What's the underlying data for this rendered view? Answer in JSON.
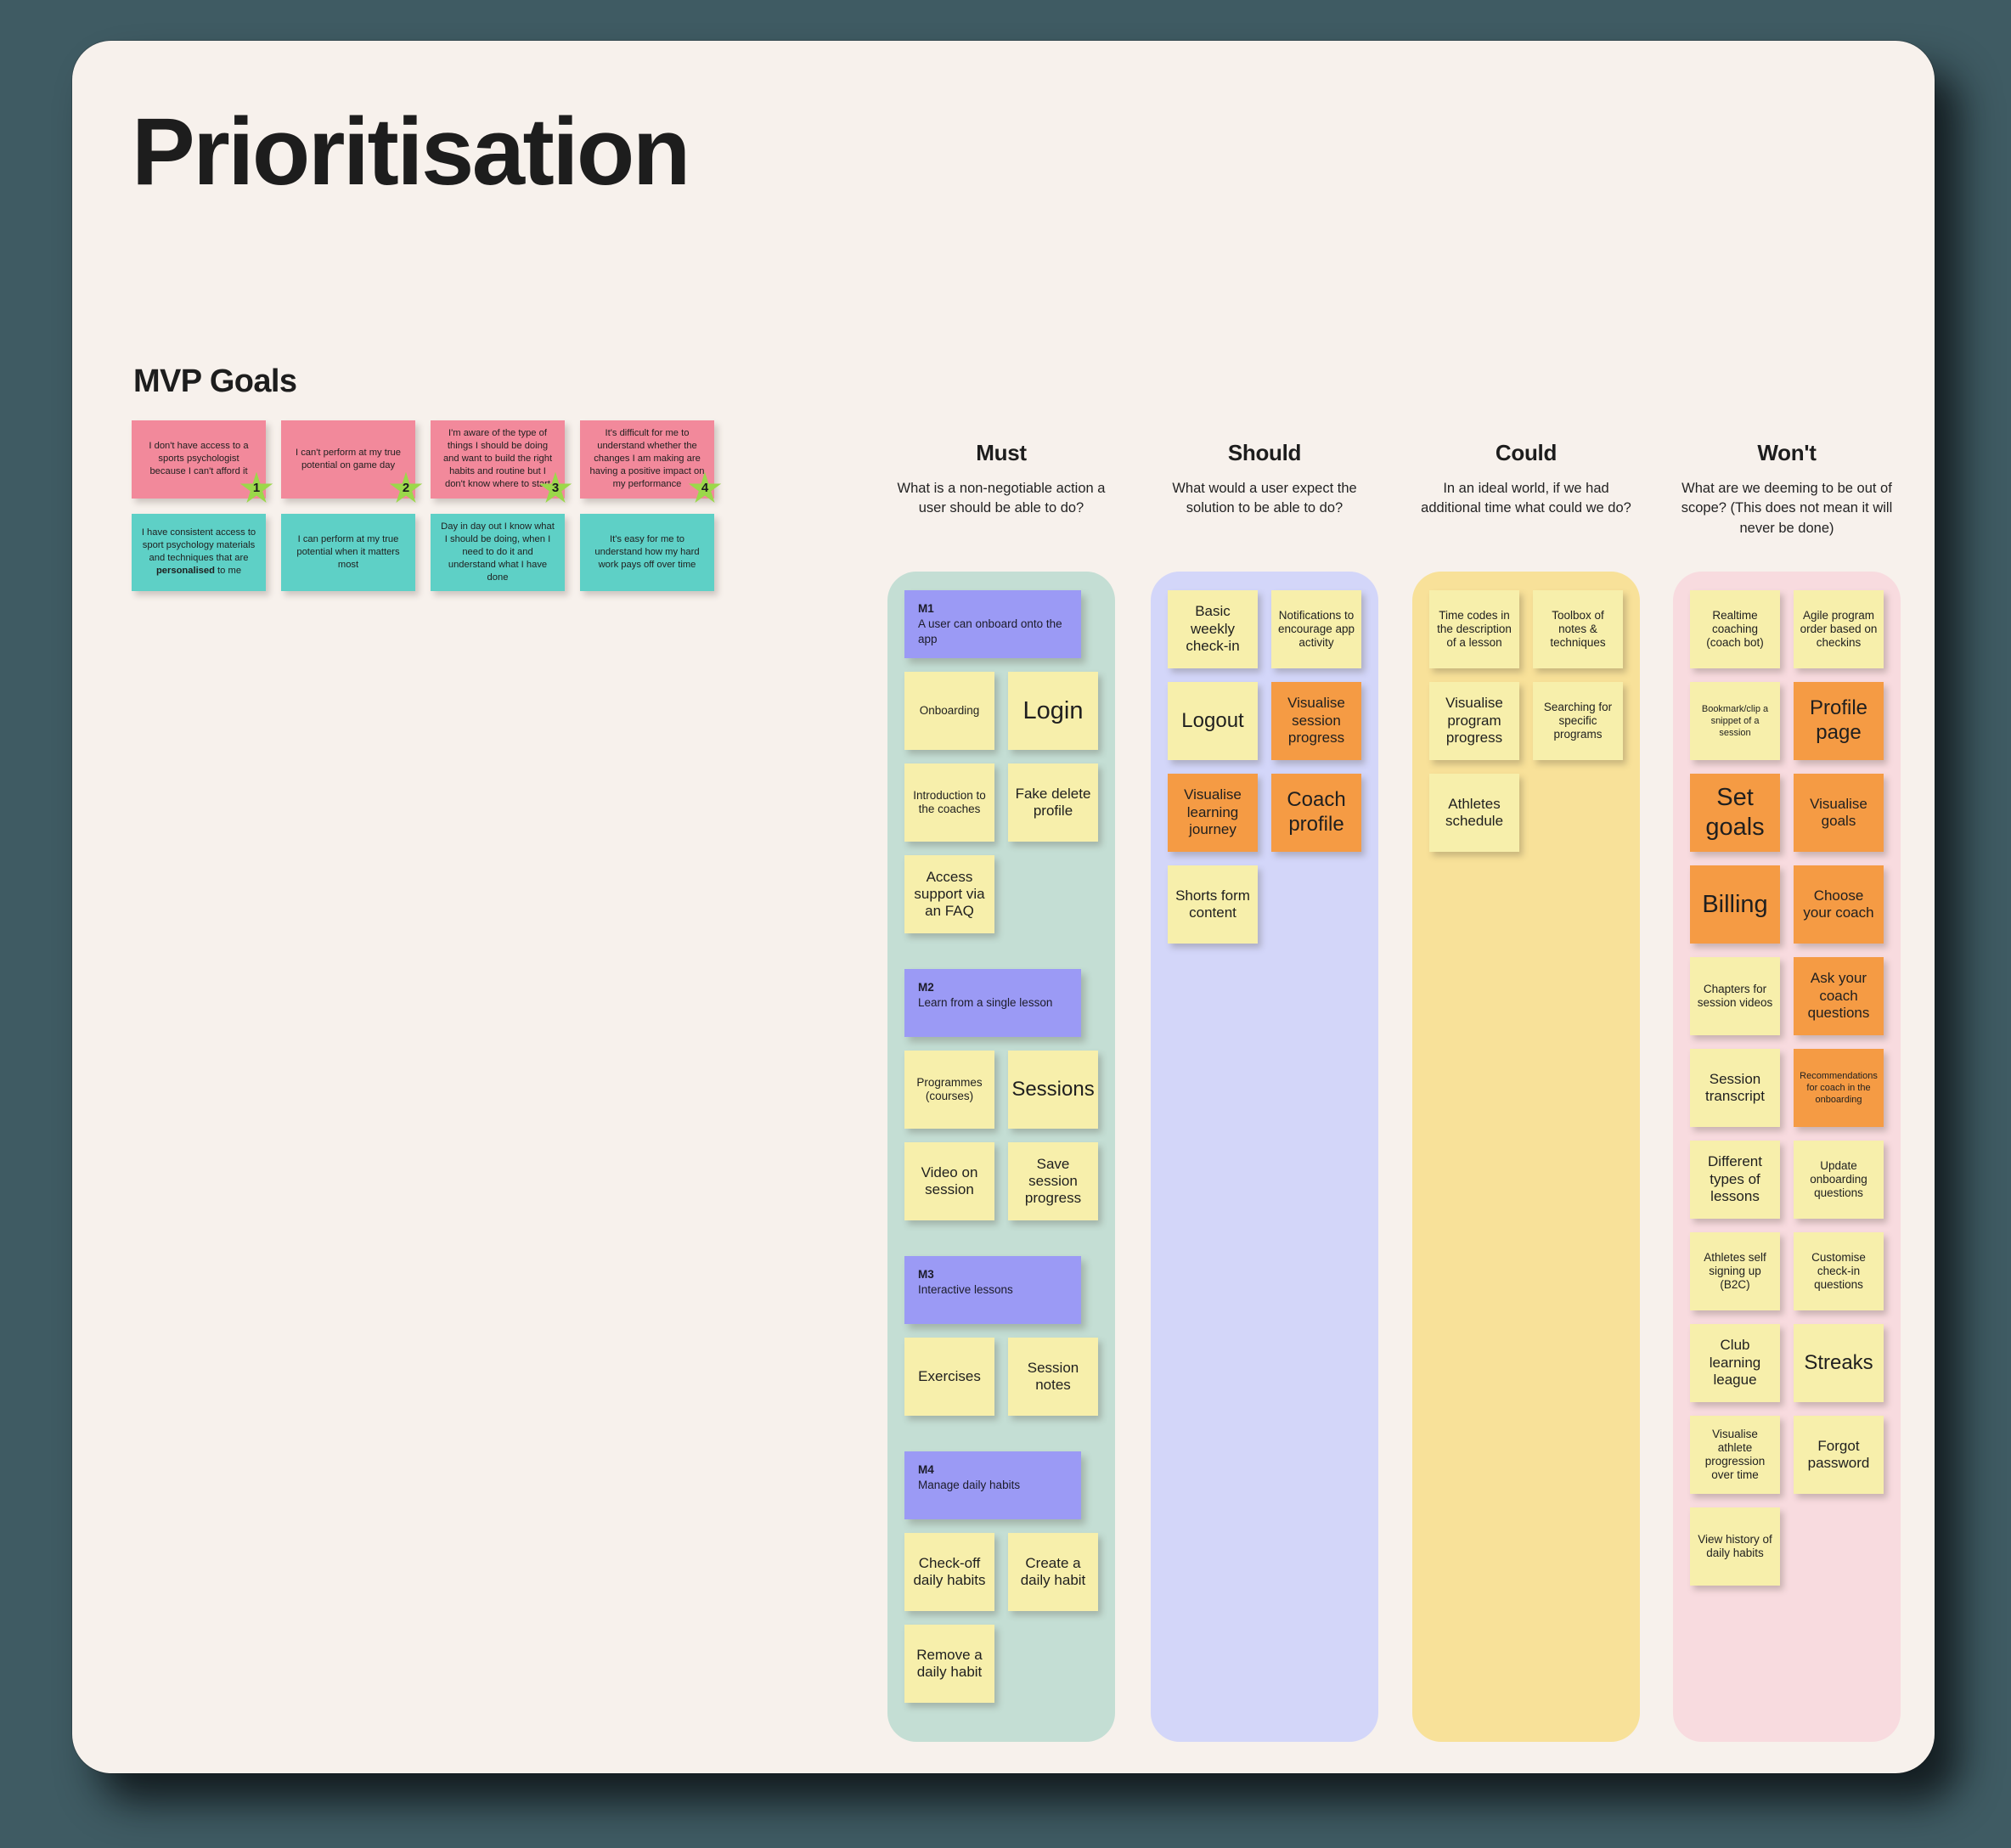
{
  "page": {
    "title": "Prioritisation",
    "mvp_heading": "MVP Goals"
  },
  "mvp_goals": {
    "pains": [
      {
        "text": "I don't have access to a sports psychologist because I can't afford it",
        "badge": "1"
      },
      {
        "text": "I can't perform at my true potential on game day",
        "badge": "2"
      },
      {
        "text": "I'm aware of the type of things I should be doing and want to build the right habits and routine but I don't know where to start",
        "badge": "3"
      },
      {
        "text": "It's difficult for me to understand whether the changes I am making are having a positive impact on my performance",
        "badge": "4"
      }
    ],
    "gains": [
      {
        "text_pre": "I have consistent access to sport psychology materials and techniques that are ",
        "text_bold": "personalised",
        "text_post": " to me"
      },
      {
        "text_pre": "I can perform at my true potential when it matters most",
        "text_bold": "",
        "text_post": ""
      },
      {
        "text_pre": "Day in day out I know what I should be doing, when I need to do it and understand what I have done",
        "text_bold": "",
        "text_post": ""
      },
      {
        "text_pre": "It's easy for me to understand how my hard work pays off over time",
        "text_bold": "",
        "text_post": ""
      }
    ]
  },
  "columns": [
    {
      "key": "must",
      "title": "Must",
      "subtitle": "What is a non-negotiable action a user should be able to do?",
      "groups": [
        {
          "id": "M1",
          "desc": "A user can onboard onto the app",
          "rows": [
            [
              {
                "label": "Onboarding",
                "color": "yellow",
                "size": "fs-sm"
              },
              {
                "label": "Login",
                "color": "yellow",
                "size": "fs-xl"
              }
            ],
            [
              {
                "label": "Introduction to the coaches",
                "color": "yellow",
                "size": "fs-sm"
              },
              {
                "label": "Fake delete profile",
                "color": "yellow",
                "size": "fs-md"
              }
            ],
            [
              {
                "label": "Access support via an FAQ",
                "color": "yellow",
                "size": "fs-md"
              }
            ]
          ]
        },
        {
          "id": "M2",
          "desc": "Learn from a single lesson",
          "rows": [
            [
              {
                "label": "Programmes (courses)",
                "color": "yellow",
                "size": "fs-sm"
              },
              {
                "label": "Sessions",
                "color": "yellow",
                "size": "fs-lg"
              }
            ],
            [
              {
                "label": "Video on session",
                "color": "yellow",
                "size": "fs-md"
              },
              {
                "label": "Save session progress",
                "color": "yellow",
                "size": "fs-md"
              }
            ]
          ]
        },
        {
          "id": "M3",
          "desc": "Interactive lessons",
          "rows": [
            [
              {
                "label": "Exercises",
                "color": "yellow",
                "size": "fs-md"
              },
              {
                "label": "Session notes",
                "color": "yellow",
                "size": "fs-md"
              }
            ]
          ]
        },
        {
          "id": "M4",
          "desc": "Manage daily habits",
          "rows": [
            [
              {
                "label": "Check-off daily habits",
                "color": "yellow",
                "size": "fs-md"
              },
              {
                "label": "Create a daily habit",
                "color": "yellow",
                "size": "fs-md"
              }
            ],
            [
              {
                "label": "Remove a daily habit",
                "color": "yellow",
                "size": "fs-md"
              }
            ]
          ]
        }
      ]
    },
    {
      "key": "should",
      "title": "Should",
      "subtitle": "What would a user expect the solution to be able to do?",
      "groups": [
        {
          "id": "",
          "desc": "",
          "rows": [
            [
              {
                "label": "Basic weekly check-in",
                "color": "yellow",
                "size": "fs-md"
              },
              {
                "label": "Notifications to encourage app activity",
                "color": "yellow",
                "size": "fs-sm"
              }
            ],
            [
              {
                "label": "Logout",
                "color": "yellow",
                "size": "fs-lg"
              },
              {
                "label": "Visualise session progress",
                "color": "orange",
                "size": "fs-md"
              }
            ],
            [
              {
                "label": "Visualise learning journey",
                "color": "orange",
                "size": "fs-md"
              },
              {
                "label": "Coach profile",
                "color": "orange",
                "size": "fs-lg"
              }
            ],
            [
              {
                "label": "Shorts form content",
                "color": "yellow",
                "size": "fs-md"
              }
            ]
          ]
        }
      ]
    },
    {
      "key": "could",
      "title": "Could",
      "subtitle": "In an ideal world, if we had additional time what could we do?",
      "groups": [
        {
          "id": "",
          "desc": "",
          "rows": [
            [
              {
                "label": "Time codes in the description of a lesson",
                "color": "yellow",
                "size": "fs-sm"
              },
              {
                "label": "Toolbox of notes & techniques",
                "color": "yellow",
                "size": "fs-sm"
              }
            ],
            [
              {
                "label": "Visualise program progress",
                "color": "yellow",
                "size": "fs-md"
              },
              {
                "label": "Searching for specific programs",
                "color": "yellow",
                "size": "fs-sm"
              }
            ],
            [
              {
                "label": "Athletes schedule",
                "color": "yellow",
                "size": "fs-md"
              }
            ]
          ]
        }
      ]
    },
    {
      "key": "wont",
      "title": "Won't",
      "subtitle": "What are we deeming to be out of scope? (This does not mean it will never be done)",
      "groups": [
        {
          "id": "",
          "desc": "",
          "rows": [
            [
              {
                "label": "Realtime coaching (coach bot)",
                "color": "yellow",
                "size": "fs-sm"
              },
              {
                "label": "Agile program order based on checkins",
                "color": "yellow",
                "size": "fs-sm"
              }
            ],
            [
              {
                "label": "Bookmark/clip a snippet of a session",
                "color": "yellow",
                "size": "fs-xs"
              },
              {
                "label": "Profile page",
                "color": "orange",
                "size": "fs-lg"
              }
            ],
            [
              {
                "label": "Set goals",
                "color": "orange",
                "size": "fs-xl"
              },
              {
                "label": "Visualise goals",
                "color": "orange",
                "size": "fs-md"
              }
            ],
            [
              {
                "label": "Billing",
                "color": "orange",
                "size": "fs-xl"
              },
              {
                "label": "Choose your coach",
                "color": "orange",
                "size": "fs-md"
              }
            ],
            [
              {
                "label": "Chapters for session videos",
                "color": "yellow",
                "size": "fs-sm"
              },
              {
                "label": "Ask your coach questions",
                "color": "orange",
                "size": "fs-md"
              }
            ],
            [
              {
                "label": "Session transcript",
                "color": "yellow",
                "size": "fs-md"
              },
              {
                "label": "Recommendations for coach in the onboarding",
                "color": "orange",
                "size": "fs-xs"
              }
            ],
            [
              {
                "label": "Different types of lessons",
                "color": "yellow",
                "size": "fs-md"
              },
              {
                "label": "Update onboarding questions",
                "color": "yellow",
                "size": "fs-sm"
              }
            ],
            [
              {
                "label": "Athletes self signing up (B2C)",
                "color": "yellow",
                "size": "fs-sm"
              },
              {
                "label": "Customise check-in questions",
                "color": "yellow",
                "size": "fs-sm"
              }
            ],
            [
              {
                "label": "Club learning league",
                "color": "yellow",
                "size": "fs-md"
              },
              {
                "label": "Streaks",
                "color": "yellow",
                "size": "fs-lg"
              }
            ],
            [
              {
                "label": "Visualise athlete progression over time",
                "color": "yellow",
                "size": "fs-sm"
              },
              {
                "label": "Forgot password",
                "color": "yellow",
                "size": "fs-md"
              }
            ],
            [
              {
                "label": "View history of daily habits",
                "color": "yellow",
                "size": "fs-sm"
              }
            ]
          ]
        }
      ]
    }
  ],
  "colors": {
    "background": "#3f5b63",
    "board": "#f7f1ec",
    "pain": "#f2899b",
    "gain": "#5ed0c6",
    "badge": "#9bd84a",
    "sticky_yellow": "#f7efab",
    "sticky_orange": "#f59b44",
    "m_card": "#9b9af5",
    "panel_must": "#c4ded4",
    "panel_should": "#d3d6f9",
    "panel_could": "#f8e199",
    "panel_wont": "#f8dbdf"
  }
}
